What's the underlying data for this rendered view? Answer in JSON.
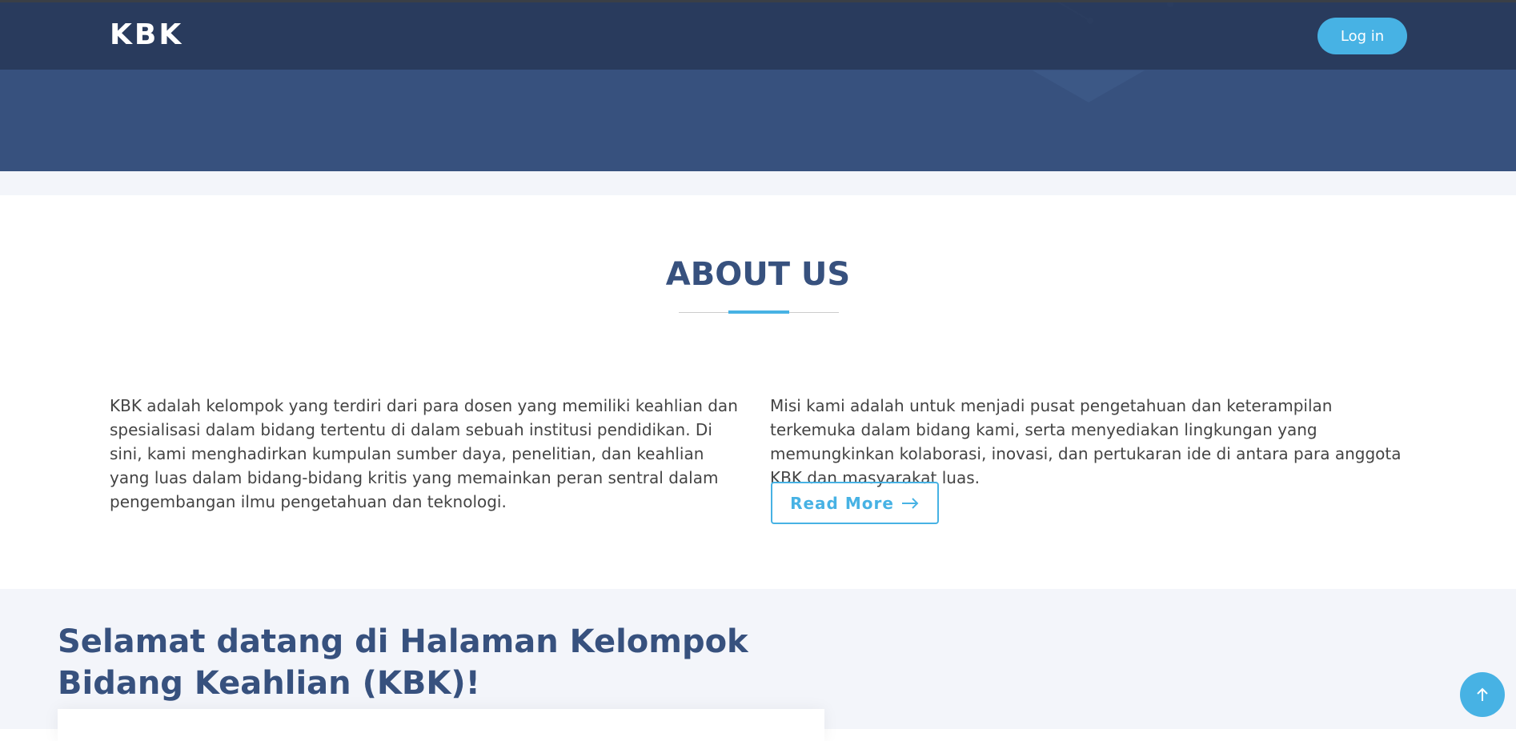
{
  "header": {
    "logo": "KBK",
    "login_label": "Log in"
  },
  "about": {
    "title": "ABOUT US",
    "left_text": "KBK adalah kelompok yang terdiri dari para dosen yang memiliki keahlian dan spesialisasi dalam bidang tertentu di dalam sebuah institusi pendidikan. Di sini, kami menghadirkan kumpulan sumber daya, penelitian, dan keahlian yang luas dalam bidang-bidang kritis yang memainkan peran sentral dalam pengembangan ilmu pengetahuan dan teknologi.",
    "right_text": "Misi kami adalah untuk menjadi pusat pengetahuan dan keterampilan terkemuka dalam bidang kami, serta menyediakan lingkungan yang memungkinkan kolaborasi, inovasi, dan pertukaran ide di antara para anggota KBK dan masyarakat luas.",
    "read_more_label": "Read More",
    "read_more_icon": "arrow-right-icon"
  },
  "welcome": {
    "title": "Selamat datang di Halaman Kelompok Bidang Keahlian (KBK)!"
  },
  "back_to_top_icon": "arrow-up-icon",
  "colors": {
    "primary": "#37517e",
    "header_bg": "#283a5a",
    "accent": "#47b2e4",
    "section_bg": "#f3f5fa",
    "text": "#444444"
  }
}
